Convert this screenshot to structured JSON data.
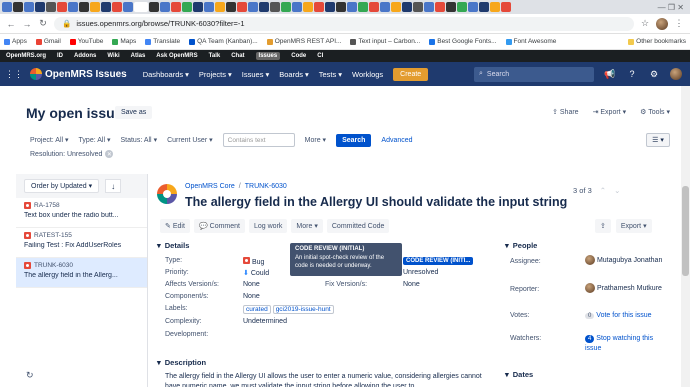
{
  "browser": {
    "url": "issues.openmrs.org/browse/TRUNK-6030?filter=-1",
    "bookmarks": [
      {
        "label": "Apps",
        "color": "#4285f4"
      },
      {
        "label": "Gmail",
        "color": "#ea4335"
      },
      {
        "label": "YouTube",
        "color": "#ff0000"
      },
      {
        "label": "Maps",
        "color": "#34a853"
      },
      {
        "label": "Translate",
        "color": "#4285f4"
      },
      {
        "label": "QA Team (Kanban)...",
        "color": "#0052cc"
      },
      {
        "label": "OpenMRS REST API...",
        "color": "#e39c2f"
      },
      {
        "label": "Text input – Carbon...",
        "color": "#555555"
      },
      {
        "label": "Best Google Fonts...",
        "color": "#1a73e8"
      },
      {
        "label": "Font Awesome",
        "color": "#339af0"
      },
      {
        "label": "Other bookmarks",
        "color": "#f2c94c"
      }
    ]
  },
  "omrsbar": {
    "items": [
      "OpenMRS.org",
      "ID",
      "Addons",
      "Wiki",
      "Atlas",
      "Ask OpenMRS",
      "Talk",
      "Chat",
      "Issues",
      "Code",
      "CI"
    ],
    "current": "Issues"
  },
  "header": {
    "logo": "OpenMRS Issues",
    "menus": [
      "Dashboards",
      "Projects",
      "Issues",
      "Boards",
      "Tests",
      "Worklogs"
    ],
    "create": "Create",
    "search_placeholder": "Search"
  },
  "page": {
    "title": "My open issues",
    "save_as": "Save as",
    "share": "Share",
    "export": "Export",
    "tools": "Tools"
  },
  "filters": {
    "project": "Project: All",
    "type": "Type: All",
    "status": "Status: All",
    "assignee": "Current User",
    "contains_placeholder": "Contains text",
    "more": "More",
    "search": "Search",
    "advanced": "Advanced",
    "resolution": "Resolution: Unresolved"
  },
  "list": {
    "order_by": "Order by Updated",
    "items": [
      {
        "key": "RA-1758",
        "summary": "Text box under the radio butt..."
      },
      {
        "key": "RATEST-155",
        "summary": "Failing Test : Fix AddUserRoles"
      },
      {
        "key": "TRUNK-6030",
        "summary": "The allergy field in the Allerg..."
      }
    ]
  },
  "issue": {
    "project": "OpenMRS Core",
    "key": "TRUNK-6030",
    "summary": "The allergy field in the Allergy UI should validate the input string",
    "pager": "3 of 3",
    "toolbar": {
      "edit": "Edit",
      "comment": "Comment",
      "log_work": "Log work",
      "more": "More",
      "review": "Committed Code",
      "export": "Export"
    },
    "details_title": "Details",
    "fields": {
      "type_label": "Type:",
      "type_value": "Bug",
      "priority_label": "Priority:",
      "priority_value": "Could",
      "affects_label": "Affects Version/s:",
      "affects_value": "None",
      "components_label": "Component/s:",
      "components_value": "None",
      "labels_label": "Labels:",
      "labels": [
        "curated",
        "gci2019-issue-hunt"
      ],
      "complexity_label": "Complexity:",
      "complexity_value": "Undetermined",
      "development_label": "Development:",
      "status_value": "CODE REVIEW (INITI...",
      "resolution_value": "Unresolved",
      "fix_label": "Fix Version/s:",
      "fix_value": "None"
    },
    "tooltip": {
      "title": "CODE REVIEW (INITIAL)",
      "body": "An initial spot-check review of the code is needed or underway."
    },
    "people": {
      "title": "People",
      "assignee_label": "Assignee:",
      "assignee": "Mutagubya Jonathan",
      "reporter_label": "Reporter:",
      "reporter": "Prathamesh Mutkure",
      "votes_label": "Votes:",
      "votes": "0",
      "vote_link": "Vote for this issue",
      "watchers_label": "Watchers:",
      "watchers": "4",
      "watch_link": "Stop watching this issue"
    },
    "dates_title": "Dates",
    "description_title": "Description",
    "description": "The allergy field in the Allergy UI allows the user to enter a numeric value, considering allergies cannot have numeric name, we must validate the input string before allowing the user to"
  }
}
